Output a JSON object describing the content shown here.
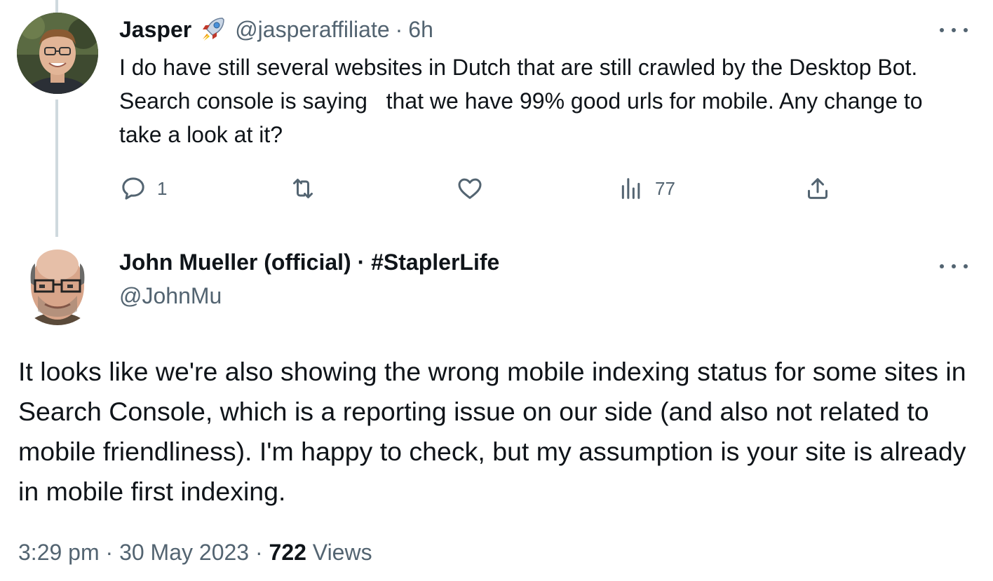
{
  "reply_tweet": {
    "author_name": "Jasper",
    "author_handle": "@jasperaffiliate",
    "separator": "·",
    "time_ago": "6h",
    "emoji": "rocket-icon",
    "text": "I do have still several websites in Dutch that are still crawled by the Desktop Bot. Search console is saying   that we have 99% good urls for mobile. Any change to take a look at it?",
    "actions": {
      "reply_count": "1",
      "repost_count": "",
      "like_count": "",
      "views_count": "77"
    }
  },
  "main_tweet": {
    "author_name": "John Mueller (official) · #StaplerLife",
    "author_handle": "@JohnMu",
    "text": "It looks like we're also showing the wrong mobile indexing status for some sites in Search Console, which is a reporting issue on our side (and also not related to mobile friendliness). I'm happy to check, but my assumption is your site is already in mobile first indexing.",
    "time": "3:29 pm",
    "date": "30 May 2023",
    "separator": "·",
    "views_count": "722",
    "views_label": "Views"
  },
  "colors": {
    "text_primary": "#0f1419",
    "text_secondary": "#536471",
    "thread_line": "#cfd9de"
  }
}
